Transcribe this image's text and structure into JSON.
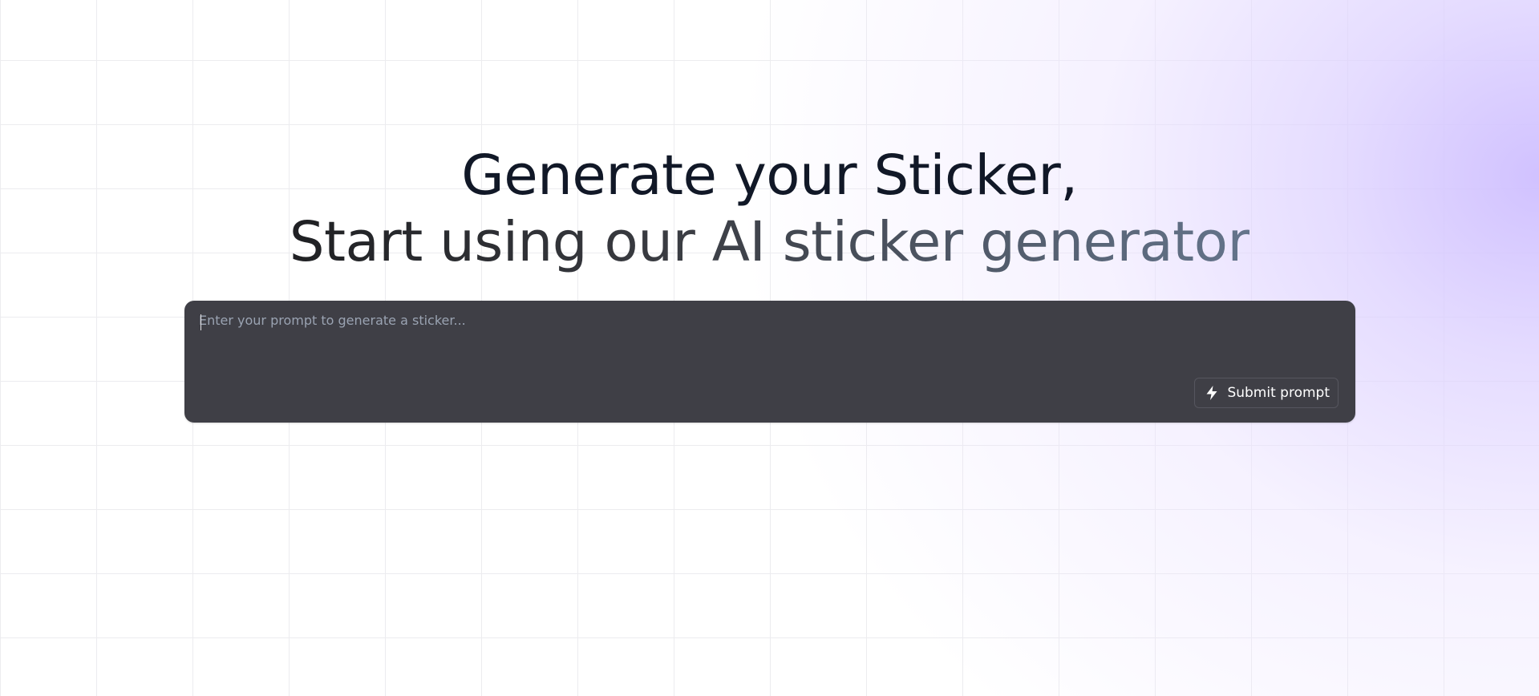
{
  "hero": {
    "title_line1": "Generate your Sticker,",
    "title_line2": "Start using our AI sticker generator"
  },
  "prompt": {
    "placeholder": "Enter your prompt to generate a sticker...",
    "value": "",
    "submit_label": "Submit prompt",
    "submit_icon": "bolt-icon"
  },
  "colors": {
    "prompt_background": "#3f3f46",
    "heading_dark": "#111827",
    "heading_gradient_end": "#64748b",
    "accent_glow": "#d6c8ff"
  }
}
